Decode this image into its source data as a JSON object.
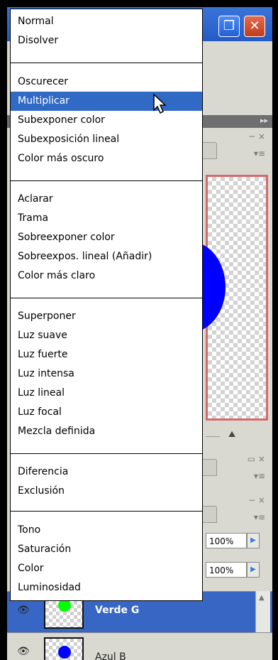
{
  "app": {
    "window_buttons": [
      "restore",
      "close"
    ],
    "panel_arrows": "▸▸",
    "zoom_icon": "mountain-icon",
    "opacity": "100%",
    "fill": "100%",
    "layers": [
      {
        "name": "Verde G",
        "color": "#00ff00",
        "selected": true
      },
      {
        "name": "Azul B",
        "color": "#0000ff",
        "selected": false
      }
    ]
  },
  "blend_menu": {
    "groups": [
      [
        "Normal",
        "Disolver"
      ],
      [
        "Oscurecer",
        "Multiplicar",
        "Subexponer color",
        "Subexposición lineal",
        "Color más oscuro"
      ],
      [
        "Aclarar",
        "Trama",
        "Sobreexponer color",
        "Sobreexpos. lineal (Añadir)",
        "Color más claro"
      ],
      [
        "Superponer",
        "Luz suave",
        "Luz fuerte",
        "Luz intensa",
        "Luz lineal",
        "Luz focal",
        "Mezcla definida"
      ],
      [
        "Diferencia",
        "Exclusión"
      ],
      [
        "Tono",
        "Saturación",
        "Color",
        "Luminosidad"
      ]
    ],
    "highlighted": "Multiplicar",
    "highlight_color": "#316ac5"
  }
}
